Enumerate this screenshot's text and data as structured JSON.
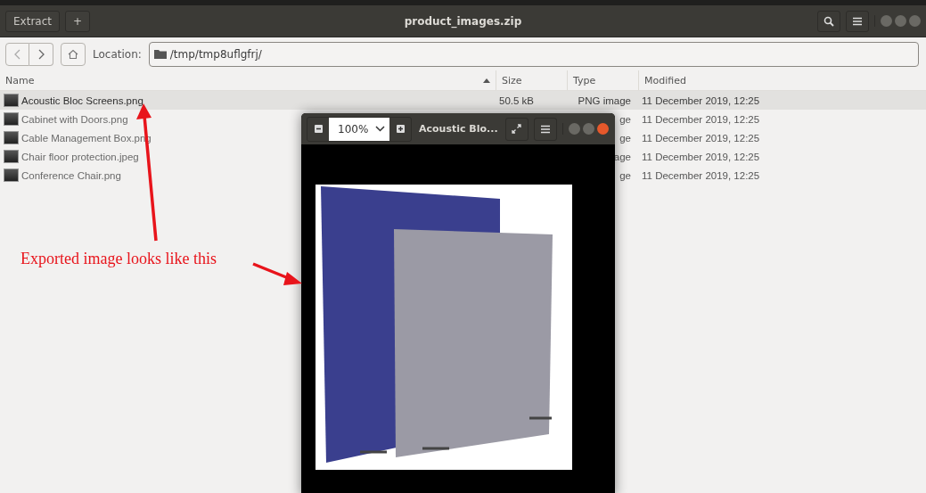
{
  "header_bar": {
    "buttons": [
      "Extract",
      "+"
    ],
    "title": "product_images.zip"
  },
  "location_bar": {
    "label": "Location:",
    "path": "/tmp/tmp8uflgfrj/"
  },
  "table": {
    "columns": [
      {
        "label": "Name",
        "sorted": true
      },
      {
        "label": "Size",
        "sorted": false
      },
      {
        "label": "Type",
        "sorted": false
      },
      {
        "label": "Modified",
        "sorted": false
      }
    ],
    "rows": [
      {
        "name": "Acoustic Bloc Screens.png",
        "size": "50.5 kB",
        "type": "PNG image",
        "modified": "11 December 2019, 12:25",
        "selected": true
      },
      {
        "name": "Cabinet with Doors.png",
        "type": "ge",
        "modified": "11 December 2019, 12:25",
        "selected": false
      },
      {
        "name": "Cable Management Box.png",
        "type": "ge",
        "modified": "11 December 2019, 12:25",
        "selected": false
      },
      {
        "name": "Chair floor protection.jpeg",
        "type": "age",
        "modified": "11 December 2019, 12:25",
        "selected": false
      },
      {
        "name": "Conference Chair.png",
        "type": "ge",
        "modified": "11 December 2019, 12:25",
        "selected": false
      }
    ]
  },
  "viewer": {
    "zoom": "100%",
    "title": "Acoustic Blo..."
  },
  "annotation": {
    "text": "Exported image looks like this"
  }
}
